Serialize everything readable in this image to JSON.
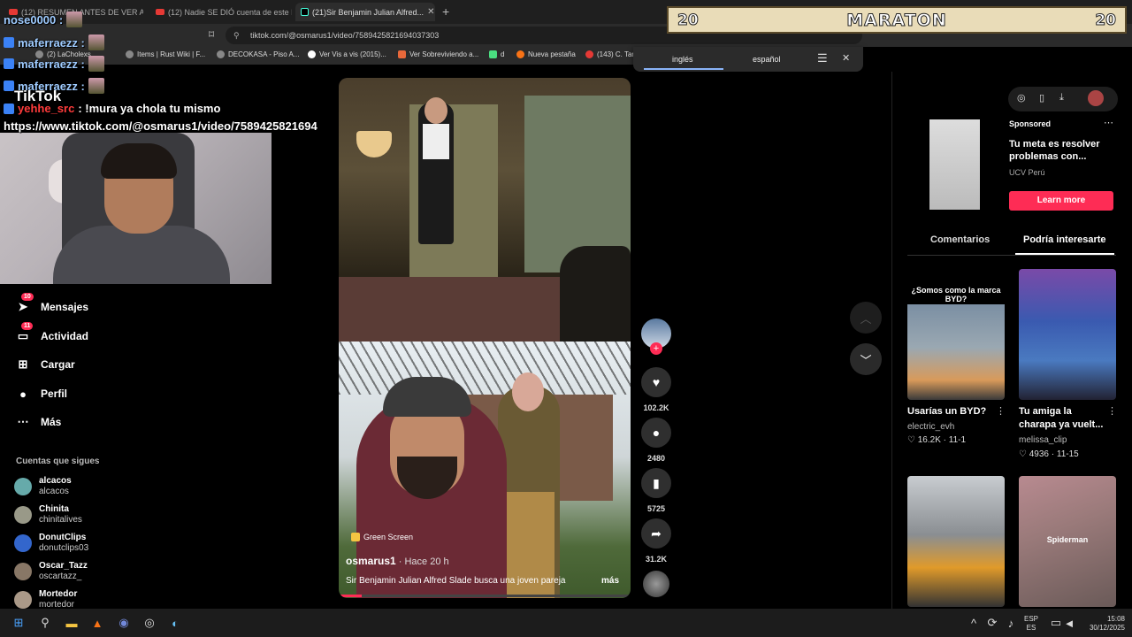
{
  "tabs": [
    {
      "label": "(12) RESUMEN ANTES DE VER A..."
    },
    {
      "label": "(12) Nadie SE DIÓ cuenta de este DE..."
    },
    {
      "label": "(21)Sir Benjamin Julian Alfred..."
    }
  ],
  "address_bar": {
    "url": "tiktok.com/@osmarus1/video/7589425821694037303"
  },
  "bookmarks": [
    {
      "label": "(2) LaCholexs"
    },
    {
      "label": "Items | Rust Wiki | F..."
    },
    {
      "label": "DECOKASA - Piso A..."
    },
    {
      "label": "Ver Vis a vis (2015)..."
    },
    {
      "label": "Ver Sobreviviendo a..."
    },
    {
      "label": "d"
    },
    {
      "label": "Nueva pestaña"
    },
    {
      "label": "(143) C. Tar"
    }
  ],
  "translate": {
    "lang_from": "inglés",
    "lang_to": "español"
  },
  "banner": {
    "left_num": "20",
    "title": "MARATON",
    "right_num": "20"
  },
  "overlay": {
    "chat": [
      {
        "user": "nose0000 :",
        "text": ""
      },
      {
        "user": "maferraezz :",
        "text": ""
      },
      {
        "user": "maferraezz :",
        "text": ""
      },
      {
        "user": "maferraezz :",
        "text": ""
      },
      {
        "user": "yehhe_src",
        "text": ": !mura ya chola tu mismo"
      }
    ],
    "tiktok_word": "TikTok",
    "url_text": "https://www.tiktok.com/@osmarus1/video/7589425821694"
  },
  "sidebar": {
    "items": [
      {
        "label": "Mensajes",
        "badge": "10"
      },
      {
        "label": "Actividad",
        "badge": "11"
      },
      {
        "label": "Cargar",
        "badge": ""
      },
      {
        "label": "Perfil",
        "badge": ""
      },
      {
        "label": "Más",
        "badge": ""
      }
    ],
    "following_title": "Cuentas que sigues",
    "following": [
      {
        "name": "alcacos",
        "handle": "alcacos"
      },
      {
        "name": "Chinita",
        "handle": "chinitalives"
      },
      {
        "name": "DonutClips",
        "handle": "donutclips03"
      },
      {
        "name": "Oscar_Tazz",
        "handle": "oscartazz_"
      },
      {
        "name": "Mortedor",
        "handle": "mortedor"
      }
    ]
  },
  "video": {
    "effect": "Green Screen",
    "author": "osmarus1",
    "time": " · Hace 20 h",
    "description": "Sir Benjamin Julian Alfred Slade busca una joven pareja",
    "more": "más",
    "progress": 0.08
  },
  "actions": {
    "likes": "102.2K",
    "comments": "2480",
    "saves": "5725",
    "shares": "31.2K"
  },
  "ad": {
    "sponsored": "Sponsored",
    "title": "Tu meta es resolver problemas con...",
    "brand": "UCV Perú",
    "cta": "Learn more"
  },
  "right_tabs": {
    "comments": "Comentarios",
    "suggested": "Podría interesarte"
  },
  "recommendations": [
    {
      "title": "Usarías un BYD?",
      "user": "electric_evh",
      "likes": "16.2K",
      "date": "11-1",
      "thumb_caption": "¿Somos como la marca BYD?"
    },
    {
      "title": "Tu amiga la charapa ya vuelt...",
      "user": "melissa_clip",
      "likes": "4936",
      "date": "11-15",
      "thumb_caption": ""
    },
    {
      "title": "",
      "user": "",
      "likes": "",
      "date": "",
      "thumb_caption": ""
    },
    {
      "title": "",
      "user": "",
      "likes": "",
      "date": "",
      "thumb_caption": "Spiderman"
    }
  ],
  "taskbar": {
    "lang_top": "ESP",
    "lang_bottom": "ES",
    "time": "15:08",
    "date": "30/12/2025"
  }
}
